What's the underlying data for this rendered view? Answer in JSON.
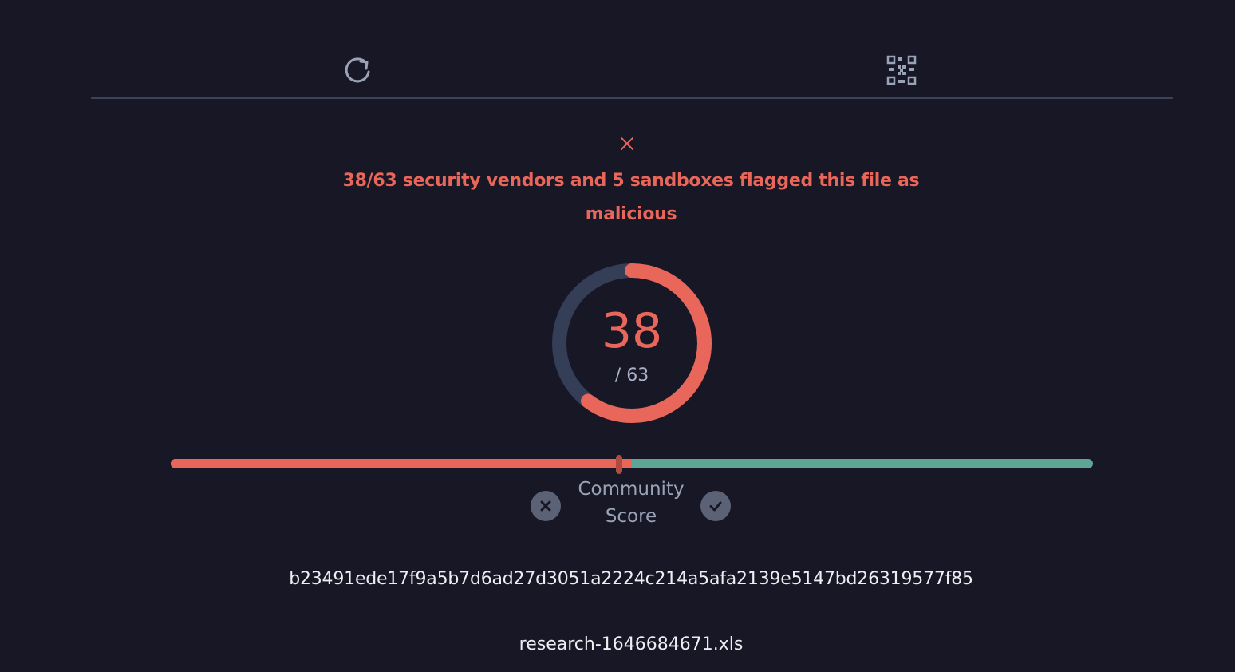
{
  "toolbar": {
    "buttons": [
      {
        "icon": "refresh-icon"
      },
      {
        "icon": "qr-code-icon"
      }
    ]
  },
  "detection": {
    "status_icon": "close-icon",
    "headline": "38/63 security vendors and 5 sandboxes flagged this file as malicious",
    "detected": 38,
    "detected_text": "38",
    "total": 63,
    "total_text": "/ 63",
    "gauge_fraction": 0.603
  },
  "community": {
    "label": "Community Score",
    "malicious_fraction": 0.5,
    "down_icon": "x-circle-icon",
    "up_icon": "check-circle-icon"
  },
  "file": {
    "hash": "b23491ede17f9a5b7d6ad27d3051a2224c214a5afa2139e5147bd26319577f85",
    "name": "research-1646684671.xls"
  },
  "colors": {
    "background": "#171725",
    "malicious": "#e8665a",
    "harmless": "#5fa596",
    "gauge_track": "#343e57",
    "muted": "#9aa3b6"
  }
}
